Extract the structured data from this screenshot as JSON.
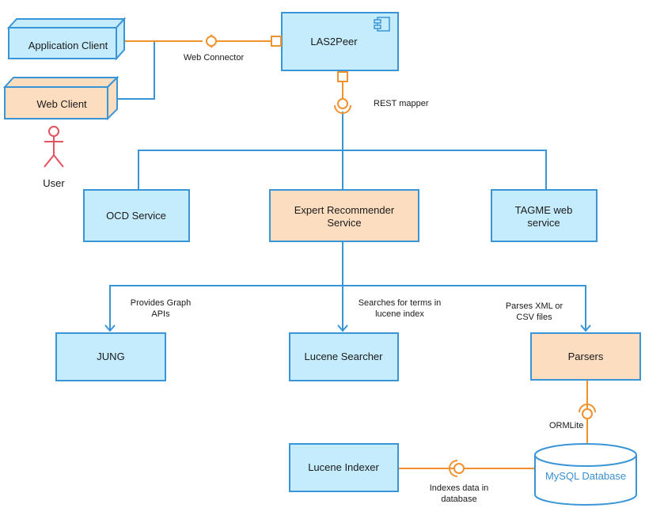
{
  "colors": {
    "box_fill_blue": "#c5ecfd",
    "box_fill_orange": "#fcddc0",
    "box_stroke": "#3a95d6",
    "connector": "#f0922e",
    "actor": "#e3525f",
    "db_text": "#3a8fd0",
    "text": "#1a1a1a"
  },
  "nodes": {
    "application_client": {
      "label": "Application Client",
      "kind": "node-3d",
      "fill": "blue"
    },
    "web_client": {
      "label": "Web Client",
      "kind": "node-3d",
      "fill": "orange"
    },
    "user": {
      "label": "User",
      "kind": "actor"
    },
    "las2peer": {
      "label": "LAS2Peer",
      "kind": "component",
      "icon": "component-icon"
    },
    "ocd_service": {
      "label": "OCD Service",
      "fill": "blue"
    },
    "expert_recommender": {
      "label_line1": "Expert Recommender",
      "label_line2": "Service",
      "fill": "orange"
    },
    "tagme": {
      "label_line1": "TAGME web",
      "label_line2": "service",
      "fill": "blue"
    },
    "jung": {
      "label": "JUNG",
      "fill": "blue"
    },
    "lucene_searcher": {
      "label": "Lucene Searcher",
      "fill": "blue"
    },
    "parsers": {
      "label": "Parsers",
      "fill": "orange"
    },
    "lucene_indexer": {
      "label": "Lucene Indexer",
      "fill": "blue"
    },
    "mysql": {
      "label": "MySQL Database",
      "kind": "database"
    }
  },
  "connectors": {
    "web_connector": {
      "label": "Web Connector"
    },
    "rest_mapper": {
      "label": "REST mapper"
    },
    "ormlite": {
      "label": "ORMLite"
    },
    "indexes": {
      "label_line1": "Indexes data in",
      "label_line2": "database"
    }
  },
  "edge_labels": {
    "jung": {
      "line1": "Provides Graph",
      "line2": "APIs"
    },
    "lucene_searcher": {
      "line1": "Searches for terms in",
      "line2": "lucene index"
    },
    "parsers": {
      "line1": "Parses XML or",
      "line2": "CSV files"
    }
  }
}
